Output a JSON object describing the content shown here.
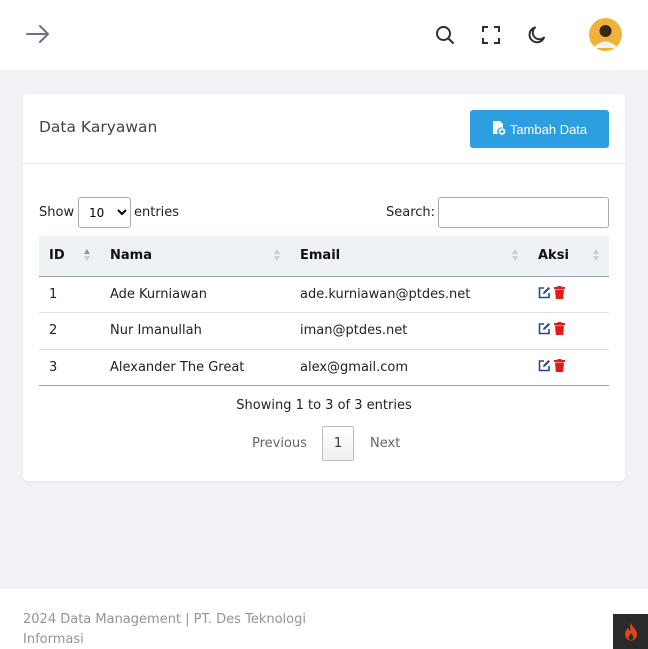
{
  "topbar": {
    "menu_icon": "arrow-right-icon",
    "search_icon": "search-icon",
    "fullscreen_icon": "fullscreen-icon",
    "theme_icon": "moon-icon",
    "avatar": "user-avatar"
  },
  "card": {
    "title": "Data Karyawan",
    "add_button_label": "Tambah Data",
    "add_button_icon": "file-add-icon",
    "accent_color": "#2d9ee0"
  },
  "controls": {
    "show_label": "Show",
    "entries_label": "entries",
    "length_value": "10",
    "search_label": "Search:",
    "search_value": ""
  },
  "table": {
    "columns": [
      "ID",
      "Nama",
      "Email",
      "Aksi"
    ],
    "rows": [
      {
        "id": "1",
        "nama": "Ade Kurniawan",
        "email": "ade.kurniawan@ptdes.net"
      },
      {
        "id": "2",
        "nama": "Nur Imanullah",
        "email": "iman@ptdes.net"
      },
      {
        "id": "3",
        "nama": "Alexander The Great",
        "email": "alex@gmail.com"
      }
    ],
    "edit_icon": "edit-icon",
    "delete_icon": "trash-icon",
    "edit_color": "#2a4a8a",
    "delete_color": "#e41b1b"
  },
  "pagination": {
    "info": "Showing 1 to 3 of 3 entries",
    "previous": "Previous",
    "current": "1",
    "next": "Next"
  },
  "footer": {
    "text": "2024 Data Management | PT. Des Teknologi Informasi",
    "badge_icon": "flame-icon"
  }
}
